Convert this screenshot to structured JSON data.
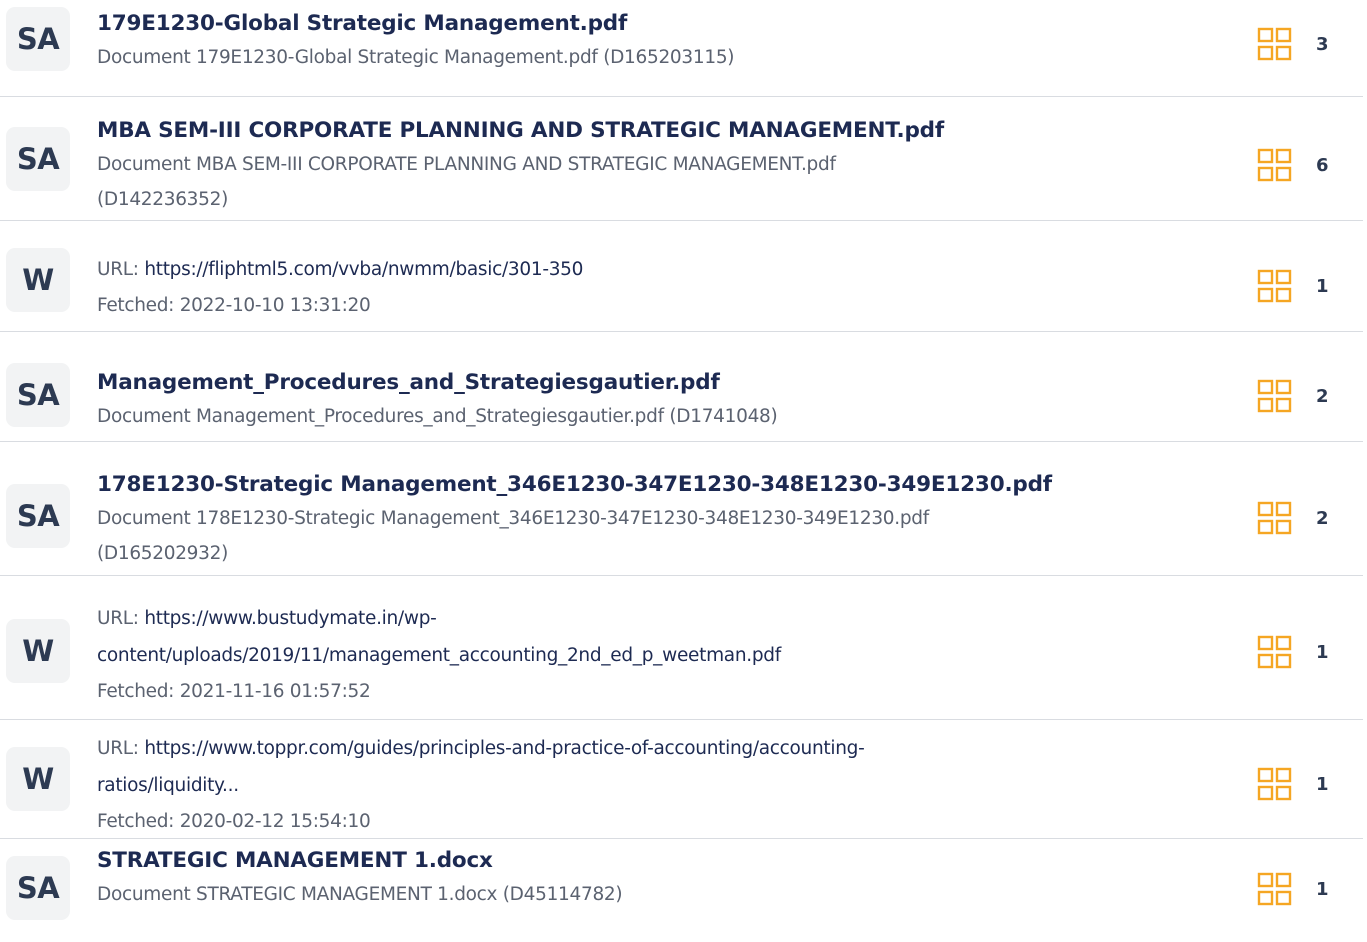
{
  "sources": [
    {
      "badge": "SA",
      "title": "179E1230-Global Strategic Management.pdf",
      "desc_lines": [
        "Document 179E1230-Global Strategic Management.pdf (D165203115)"
      ],
      "count": "3"
    },
    {
      "badge": "SA",
      "title": "MBA SEM-III CORPORATE PLANNING AND STRATEGIC MANAGEMENT.pdf",
      "desc_lines": [
        "Document MBA SEM-III CORPORATE PLANNING AND STRATEGIC MANAGEMENT.pdf",
        "(D142236352)"
      ],
      "count": "6"
    },
    {
      "badge": "W",
      "url_label": "URL: ",
      "url_lines": [
        "https://fliphtml5.com/vvba/nwmm/basic/301-350"
      ],
      "fetched": "Fetched: 2022-10-10 13:31:20",
      "count": "1"
    },
    {
      "badge": "SA",
      "title": "Management_Procedures_and_Strategiesgautier.pdf",
      "desc_lines": [
        "Document Management_Procedures_and_Strategiesgautier.pdf (D1741048)"
      ],
      "count": "2"
    },
    {
      "badge": "SA",
      "title": "178E1230-Strategic Management_346E1230-347E1230-348E1230-349E1230.pdf",
      "desc_lines": [
        "Document 178E1230-Strategic Management_346E1230-347E1230-348E1230-349E1230.pdf",
        "(D165202932)"
      ],
      "count": "2"
    },
    {
      "badge": "W",
      "url_label": "URL: ",
      "url_lines": [
        "https://www.bustudymate.in/wp-",
        "content/uploads/2019/11/management_accounting_2nd_ed_p_weetman.pdf"
      ],
      "fetched": "Fetched: 2021-11-16 01:57:52",
      "count": "1"
    },
    {
      "badge": "W",
      "url_label": "URL: ",
      "url_lines": [
        "https://www.toppr.com/guides/principles-and-practice-of-accounting/accounting-",
        "ratios/liquidity..."
      ],
      "fetched": "Fetched: 2020-02-12 15:54:10",
      "count": "1"
    },
    {
      "badge": "SA",
      "title": "STRATEGIC MANAGEMENT 1.docx",
      "desc_lines": [
        "Document STRATEGIC MANAGEMENT 1.docx (D45114782)"
      ],
      "count": "1"
    }
  ],
  "colors": {
    "icon_accent": "#f5a623",
    "badge_bg": "#f2f3f4",
    "title": "#1d2a52",
    "muted": "#5b6270",
    "divider": "#d9dce1"
  },
  "icons": {
    "match_icon": "grid-four-squares-icon"
  }
}
